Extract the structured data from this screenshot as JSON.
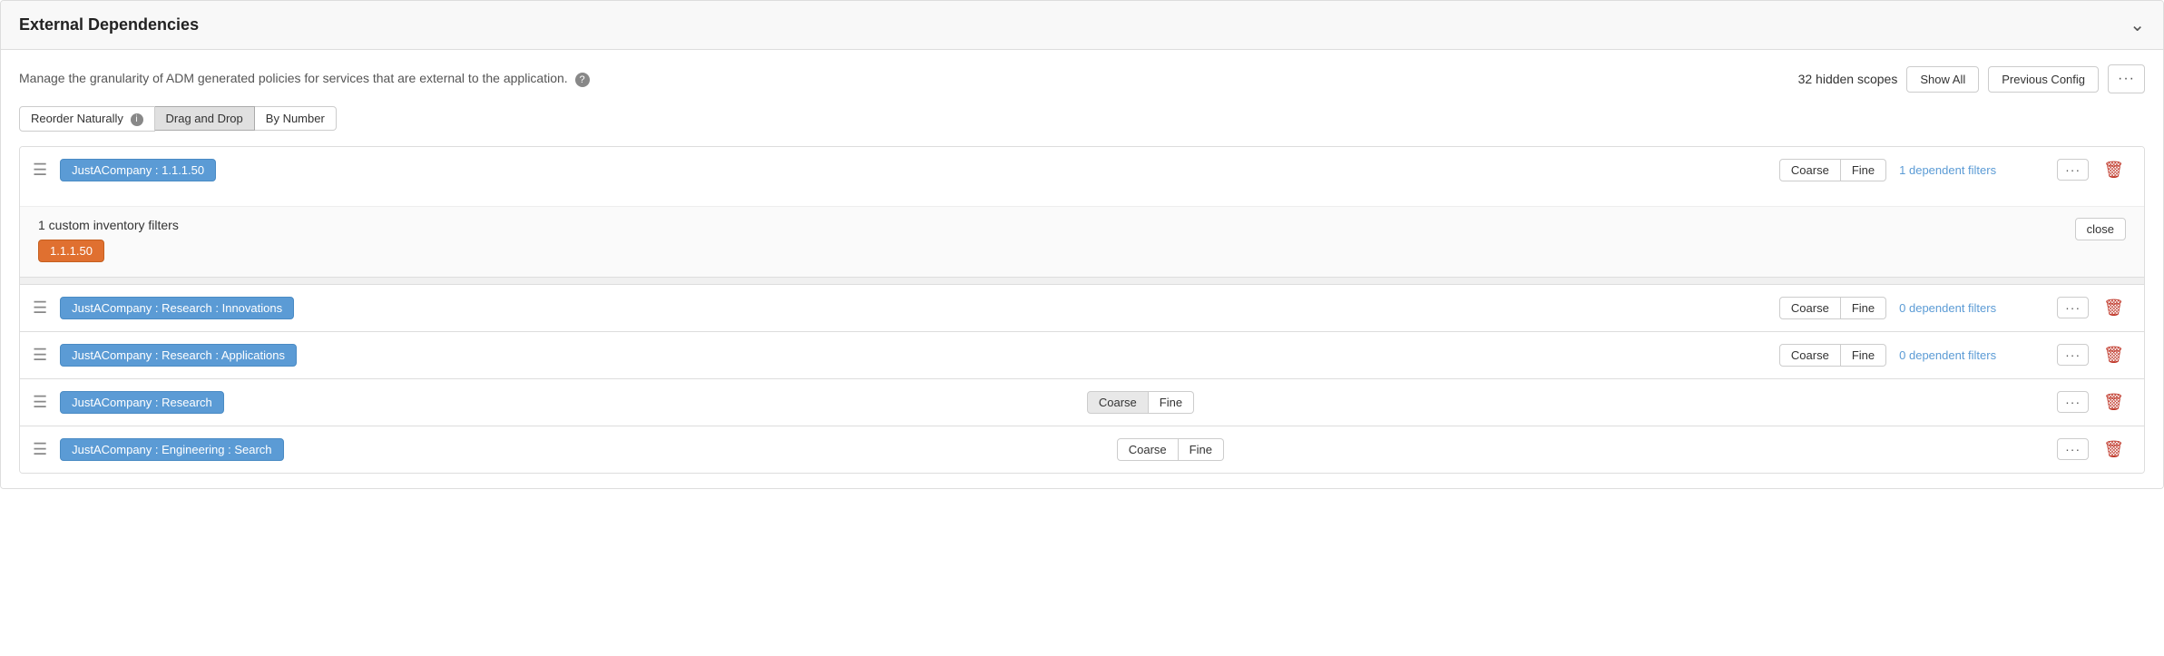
{
  "panel": {
    "title": "External Dependencies",
    "description": "Manage the granularity of ADM generated policies for services that are external to the application.",
    "hidden_scopes_label": "32 hidden scopes",
    "show_all_label": "Show All",
    "previous_config_label": "Previous Config",
    "dots_label": "···"
  },
  "reorder": {
    "naturally_label": "Reorder Naturally",
    "drag_drop_label": "Drag and Drop",
    "by_number_label": "By Number"
  },
  "items": [
    {
      "id": "item1",
      "tag_label": "JustACompany : 1.1.1.50",
      "tag_color": "blue",
      "coarse_label": "Coarse",
      "fine_label": "Fine",
      "dependent_filters_label": "1 dependent filters",
      "expanded": true,
      "sub_title": "1 custom inventory filters",
      "sub_tags": [
        {
          "label": "1.1.1.50",
          "color": "orange"
        }
      ],
      "close_label": "close"
    },
    {
      "id": "item2",
      "tag_label": "JustACompany : Research : Innovations",
      "tag_color": "blue",
      "coarse_label": "Coarse",
      "fine_label": "Fine",
      "dependent_filters_label": "0 dependent filters",
      "expanded": false
    },
    {
      "id": "item3",
      "tag_label": "JustACompany : Research : Applications",
      "tag_color": "blue",
      "coarse_label": "Coarse",
      "fine_label": "Fine",
      "dependent_filters_label": "0 dependent filters",
      "expanded": false
    },
    {
      "id": "item4",
      "tag_label": "JustACompany : Research",
      "tag_color": "blue",
      "coarse_label": "Coarse",
      "fine_label": "Fine",
      "dependent_filters_label": "",
      "expanded": false
    },
    {
      "id": "item5",
      "tag_label": "JustACompany : Engineering : Search",
      "tag_color": "blue",
      "coarse_label": "Coarse",
      "fine_label": "Fine",
      "dependent_filters_label": "",
      "expanded": false
    }
  ]
}
